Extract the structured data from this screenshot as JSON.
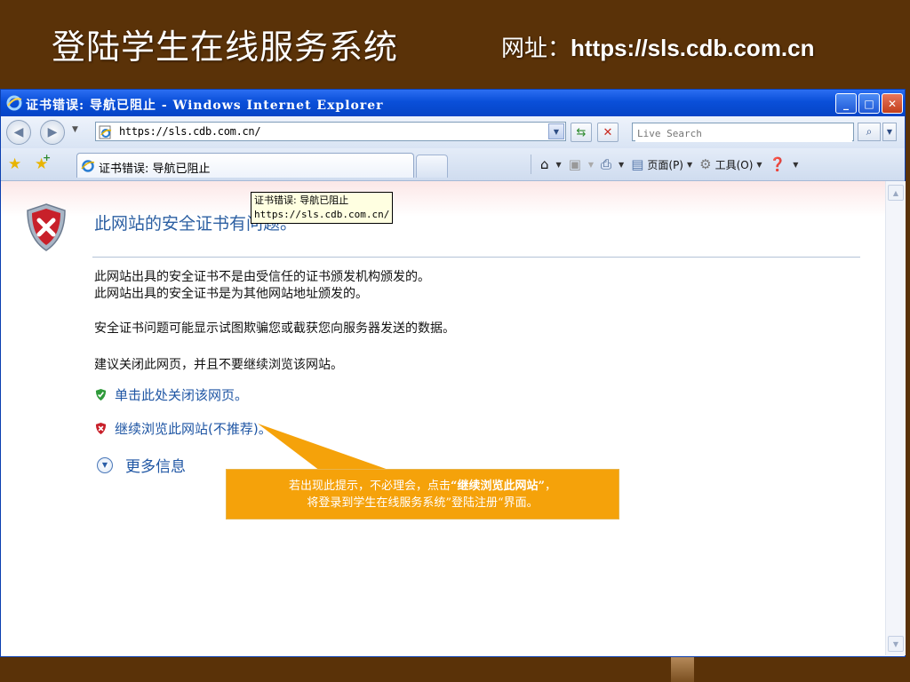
{
  "slide": {
    "title": "登陆学生在线服务系统",
    "url_label": "网址：",
    "url": "https://sls.cdb.com.cn"
  },
  "window": {
    "title": "证书错误: 导航已阻止 - Windows Internet Explorer",
    "minimize": "_",
    "maximize": "□",
    "close": "✕"
  },
  "address_bar": {
    "url": "https://sls.cdb.com.cn/",
    "search_placeholder": "Live Search"
  },
  "tab": {
    "label": "证书错误: 导航已阻止"
  },
  "command_bar": {
    "page_label": "页面(P)",
    "tools_label": "工具(O)"
  },
  "tooltip": {
    "line1": "证书错误: 导航已阻止",
    "line2": "https://sls.cdb.com.cn/"
  },
  "content": {
    "heading": "此网站的安全证书有问题。",
    "line1": "此网站出具的安全证书不是由受信任的证书颁发机构颁发的。",
    "line2": "此网站出具的安全证书是为其他网站地址颁发的。",
    "line3": "安全证书问题可能显示试图欺骗您或截获您向服务器发送的数据。",
    "line4": "建议关闭此网页，并且不要继续浏览该网站。",
    "close_link": "单击此处关闭该网页。",
    "continue_link": "继续浏览此网站(不推荐)。",
    "more_info": "更多信息"
  },
  "callout": {
    "prefix": "若出现此提示，不必理会，点击",
    "highlight": "“继续浏览此网站”",
    "suffix": "，",
    "line2": "将登录到学生在线服务系统”登陆注册“界面。"
  },
  "colors": {
    "slide_bg": "#5a3208",
    "callout": "#f5a20a",
    "link": "#1f56a4",
    "heading": "#2c5fa2"
  }
}
